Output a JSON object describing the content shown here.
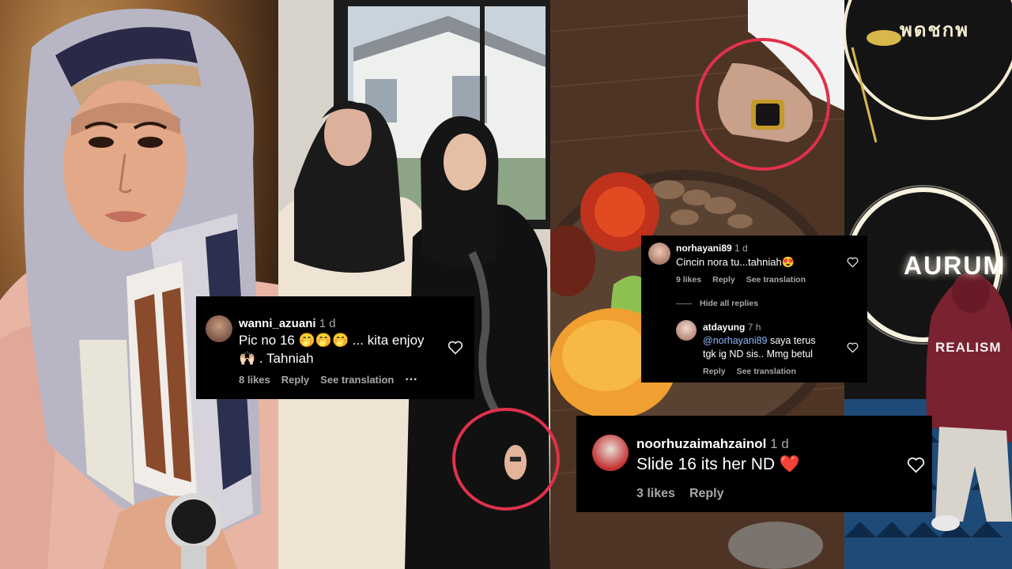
{
  "signs": {
    "top": "พดชกพ",
    "aurum": "AURUM"
  },
  "hoodie_print": "REALISM",
  "comments": [
    {
      "username": "wanni_azuani",
      "time": "1 d",
      "text_line1": "Pic no 16 🤭🤭🤭 ... kita enjoy",
      "text_line2": "🙌🏻 . Tahniah",
      "likes": "8 likes",
      "reply": "Reply",
      "translate": "See translation",
      "more": "···"
    },
    {
      "username": "norhayani89",
      "time": "1 d",
      "text": "Cincin nora tu...tahniah😍",
      "likes": "9 likes",
      "reply": "Reply",
      "translate": "See translation",
      "hide_replies": "Hide all replies"
    },
    {
      "username": "atdayung",
      "time": "7 h",
      "mention": "@norhayani89",
      "text_line1_rest": " saya terus",
      "text_line2": "tgk ig ND sis.. Mmg betul",
      "reply": "Reply",
      "translate": "See translation"
    },
    {
      "username": "noorhuzaimahzainol",
      "time": "1 d",
      "text": "Slide 16 its her ND ❤️",
      "likes": "3 likes",
      "reply": "Reply"
    }
  ],
  "colors": {
    "highlight_circle": "#e0314b",
    "card_bg": "#000000",
    "meta_text": "#a8a8a8",
    "mention": "#8fb8ff"
  }
}
